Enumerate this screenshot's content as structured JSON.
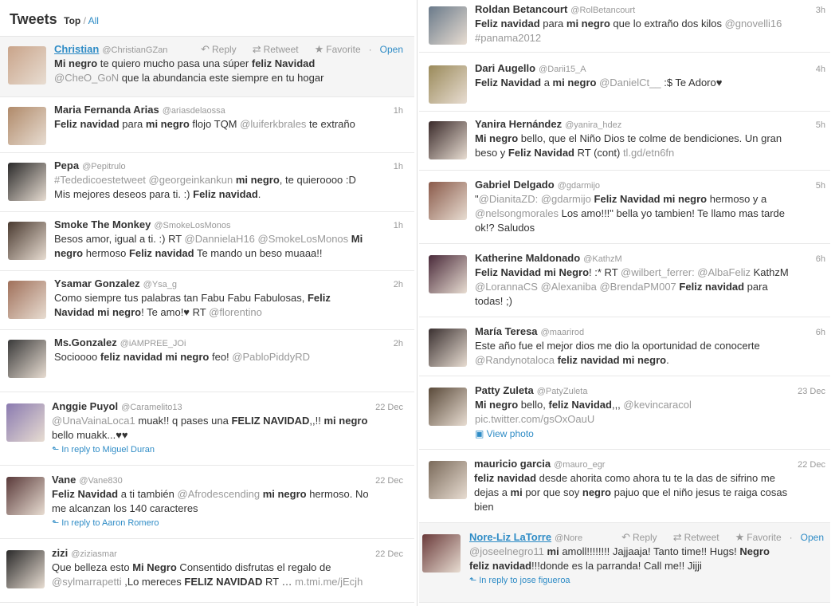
{
  "header": {
    "title": "Tweets",
    "filter_top": "Top",
    "filter_sep": "/",
    "filter_all": "All"
  },
  "actions": {
    "reply": "Reply",
    "retweet": "Retweet",
    "favorite": "Favorite",
    "dot": "·",
    "open": "Open"
  },
  "left": [
    {
      "name": "Christian",
      "handle": "@ChristianGZan",
      "time": "",
      "selected": true,
      "avatar_color": "#c9a48a",
      "body": [
        [
          "b",
          "Mi negro"
        ],
        [
          "t",
          " te quiero mucho pasa una súper "
        ],
        [
          "b",
          "feliz Navidad"
        ],
        [
          "br"
        ],
        [
          "m",
          "@CheO_GoN"
        ],
        [
          "t",
          " que la abundancia este siempre en tu hogar"
        ]
      ]
    },
    {
      "name": "Maria Fernanda Arias",
      "handle": "@ariasdelaossa",
      "time": "1h",
      "avatar_color": "#b08a6a",
      "body": [
        [
          "b",
          "Feliz navidad"
        ],
        [
          "t",
          " para "
        ],
        [
          "b",
          "mi negro"
        ],
        [
          "t",
          " flojo TQM "
        ],
        [
          "m",
          "@luiferkbrales"
        ],
        [
          "t",
          " te extraño"
        ]
      ]
    },
    {
      "name": "Pepa",
      "handle": "@Pepitrulo",
      "time": "1h",
      "avatar_color": "#2a2a2a",
      "body": [
        [
          "m",
          "#Tededicoestetweet @georgeinkankun"
        ],
        [
          "t",
          " "
        ],
        [
          "b",
          "mi negro"
        ],
        [
          "t",
          ", te quieroooo :D"
        ],
        [
          "br"
        ],
        [
          "t",
          "Mis mejores deseos para ti. :) "
        ],
        [
          "b",
          "Feliz navidad"
        ],
        [
          "t",
          "."
        ]
      ]
    },
    {
      "name": "Smoke The Monkey",
      "handle": "@SmokeLosMonos",
      "time": "1h",
      "avatar_color": "#4a3a30",
      "body": [
        [
          "t",
          "Besos amor, igual a ti. :) RT "
        ],
        [
          "m",
          "@DannielaH16 @SmokeLosMonos"
        ],
        [
          "t",
          " "
        ],
        [
          "b",
          "Mi"
        ],
        [
          "br"
        ],
        [
          "b",
          "negro"
        ],
        [
          "t",
          " hermoso "
        ],
        [
          "b",
          "Feliz navidad"
        ],
        [
          "t",
          " Te mando un beso muaaa!!"
        ]
      ]
    },
    {
      "name": "Ysamar Gonzalez",
      "handle": "@Ysa_g",
      "time": "2h",
      "avatar_color": "#a0705a",
      "body": [
        [
          "t",
          "Como siempre tus palabras tan Fabu Fabu Fabulosas, "
        ],
        [
          "b",
          "Feliz"
        ],
        [
          "br"
        ],
        [
          "b",
          "Navidad mi negro"
        ],
        [
          "t",
          "! Te amo!♥ RT "
        ],
        [
          "m",
          "@florentino"
        ]
      ]
    },
    {
      "name": "Ms.Gonzalez",
      "handle": "@iAMPREE_JOi",
      "time": "2h",
      "avatar_color": "#3a3a3a",
      "body": [
        [
          "t",
          "Socioooo "
        ],
        [
          "b",
          "feliz navidad mi negro"
        ],
        [
          "t",
          " feo! "
        ],
        [
          "m",
          "@PabloPiddyRD"
        ]
      ]
    },
    {
      "name": "Anggie Puyol",
      "handle": "@Caramelito13",
      "time": "22 Dec",
      "avatar_color": "#8a7ab0",
      "reply": "In reply to Miguel Duran",
      "body": [
        [
          "m",
          "@UnaVainaLoca1"
        ],
        [
          "t",
          " muak!! q pases una "
        ],
        [
          "b",
          "FELIZ NAVIDAD"
        ],
        [
          "t",
          ",,!! "
        ],
        [
          "b",
          "mi negro"
        ],
        [
          "br"
        ],
        [
          "t",
          "bello muakk...♥♥"
        ]
      ]
    },
    {
      "name": "Vane",
      "handle": "@Vane830",
      "time": "22 Dec",
      "avatar_color": "#5a3a3a",
      "reply": "In reply to Aaron Romero",
      "body": [
        [
          "b",
          "Feliz Navidad"
        ],
        [
          "t",
          " a ti también "
        ],
        [
          "m",
          "@Afrodescending"
        ],
        [
          "t",
          " "
        ],
        [
          "b",
          "mi negro"
        ],
        [
          "t",
          " hermoso. No"
        ],
        [
          "br"
        ],
        [
          "t",
          "me alcanzan los 140 caracteres"
        ]
      ]
    },
    {
      "name": "zizi",
      "handle": "@ziziasmar",
      "time": "22 Dec",
      "avatar_color": "#2a2a2a",
      "body": [
        [
          "t",
          "Que belleza esto "
        ],
        [
          "b",
          "Mi Negro"
        ],
        [
          "t",
          " Consentido disfrutas el regalo de"
        ],
        [
          "br"
        ],
        [
          "m",
          "@sylmarrapetti"
        ],
        [
          "t",
          " ,Lo mereces "
        ],
        [
          "b",
          "FELIZ NAVIDAD"
        ],
        [
          "t",
          " RT … "
        ],
        [
          "m",
          "m.tmi.me/jEcjh"
        ]
      ]
    }
  ],
  "right": [
    {
      "name": "Roldan Betancourt",
      "handle": "@RolBetancourt",
      "time": "3h",
      "avatar_color": "#6a7a8a",
      "body": [
        [
          "b",
          "Feliz navidad"
        ],
        [
          "t",
          " para "
        ],
        [
          "b",
          "mi negro"
        ],
        [
          "t",
          " que lo extraño dos kilos "
        ],
        [
          "m",
          "@gnovelli16"
        ],
        [
          "br"
        ],
        [
          "m",
          "#panama2012"
        ]
      ]
    },
    {
      "name": "Dari Augello",
      "handle": "@Darii15_A",
      "time": "4h",
      "avatar_color": "#9a8a5a",
      "body": [
        [
          "b",
          "Feliz Navidad"
        ],
        [
          "t",
          " a "
        ],
        [
          "b",
          "mi negro"
        ],
        [
          "t",
          " "
        ],
        [
          "m",
          "@DanielCt__"
        ],
        [
          "t",
          " :$ Te Adoro♥"
        ]
      ]
    },
    {
      "name": "Yanira Hernández",
      "handle": "@yanira_hdez",
      "time": "5h",
      "avatar_color": "#3a2a2a",
      "body": [
        [
          "b",
          "Mi negro"
        ],
        [
          "t",
          " bello, que el Niño Dios te colme de bendiciones. Un gran"
        ],
        [
          "br"
        ],
        [
          "t",
          "beso y "
        ],
        [
          "b",
          "Feliz Navidad"
        ],
        [
          "t",
          " RT (cont) "
        ],
        [
          "m",
          "tl.gd/etn6fn"
        ]
      ]
    },
    {
      "name": "Gabriel Delgado",
      "handle": "@gdarmijo",
      "time": "5h",
      "avatar_color": "#8a5a4a",
      "body": [
        [
          "t",
          "\""
        ],
        [
          "m",
          "@DianitaZD: @gdarmijo"
        ],
        [
          "t",
          " "
        ],
        [
          "b",
          "Feliz Navidad mi negro"
        ],
        [
          "t",
          " hermoso y a"
        ],
        [
          "br"
        ],
        [
          "m",
          "@nelsongmorales"
        ],
        [
          "t",
          " Los amo!!!\" bella yo tambien! Te llamo mas tarde"
        ],
        [
          "br"
        ],
        [
          "t",
          "ok!? Saludos"
        ]
      ]
    },
    {
      "name": "Katherine Maldonado",
      "handle": "@KathzM",
      "time": "6h",
      "avatar_color": "#4a2a3a",
      "body": [
        [
          "b",
          "Feliz Navidad mi Negro"
        ],
        [
          "t",
          "! :* RT "
        ],
        [
          "m",
          "@wilbert_ferrer: @AlbaFeliz"
        ],
        [
          "t",
          " KathzM"
        ],
        [
          "br"
        ],
        [
          "m",
          "@LorannaCS @Alexaniba @BrendaPM007"
        ],
        [
          "t",
          " "
        ],
        [
          "b",
          "Feliz navidad"
        ],
        [
          "t",
          " para"
        ],
        [
          "br"
        ],
        [
          "t",
          "todas! ;)"
        ]
      ]
    },
    {
      "name": "María Teresa",
      "handle": "@maarirod",
      "time": "6h",
      "avatar_color": "#3a3030",
      "body": [
        [
          "t",
          "Este año fue el mejor dios me dio la oportunidad de conocerte"
        ],
        [
          "br"
        ],
        [
          "m",
          "@Randynotaloca"
        ],
        [
          "t",
          " "
        ],
        [
          "b",
          "feliz navidad mi negro"
        ],
        [
          "t",
          "."
        ]
      ]
    },
    {
      "name": "Patty Zuleta",
      "handle": "@PatyZuleta",
      "time": "23 Dec",
      "avatar_color": "#5a4a3a",
      "viewphoto": "View photo",
      "body": [
        [
          "b",
          "Mi negro"
        ],
        [
          "t",
          " bello, "
        ],
        [
          "b",
          "feliz Navidad"
        ],
        [
          "t",
          ",,, "
        ],
        [
          "m",
          "@kevincaracol"
        ],
        [
          "br"
        ],
        [
          "m",
          "pic.twitter.com/gsOxOauU"
        ]
      ]
    },
    {
      "name": "mauricio garcia",
      "handle": "@mauro_egr",
      "time": "22 Dec",
      "avatar_color": "#7a6a5a",
      "body": [
        [
          "b",
          "feliz navidad"
        ],
        [
          "t",
          " desde ahorita como ahora tu te la das de sifrino me"
        ],
        [
          "br"
        ],
        [
          "t",
          "dejas a "
        ],
        [
          "b",
          "mi"
        ],
        [
          "t",
          " por que soy "
        ],
        [
          "b",
          "negro"
        ],
        [
          "t",
          " pajuo que el niño jesus te raiga cosas"
        ],
        [
          "br"
        ],
        [
          "t",
          "bien"
        ]
      ]
    },
    {
      "name": "Nore-Liz LaTorre",
      "handle": "@Nore",
      "time": "",
      "selected": true,
      "avatar_color": "#6a3a3a",
      "reply": "In reply to jose figueroa",
      "body": [
        [
          "m",
          "@joseelnegro11"
        ],
        [
          "t",
          " "
        ],
        [
          "b",
          "mi"
        ],
        [
          "t",
          " amoll!!!!!!!! Jajjaaja! Tanto time!! Hugs! "
        ],
        [
          "b",
          "Negro"
        ],
        [
          "br"
        ],
        [
          "b",
          "feliz navidad"
        ],
        [
          "t",
          "!!!donde es la parranda! Call me!! Jijji"
        ]
      ]
    }
  ]
}
